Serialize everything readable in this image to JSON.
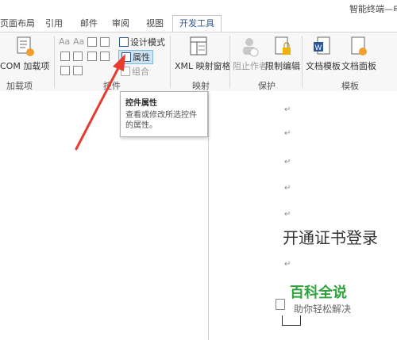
{
  "window": {
    "title": "智能终端—电子"
  },
  "tabs": [
    "页面布局",
    "引用",
    "邮件",
    "审阅",
    "视图",
    "开发工具"
  ],
  "ribbon": {
    "addins": {
      "com_label": "COM 加载项",
      "group": "加载项"
    },
    "controls": {
      "design_mode": "设计模式",
      "properties": "属性",
      "group_btn": "组合",
      "group": "控件"
    },
    "mapping": {
      "xml_pane": "XML 映射窗格",
      "group": "映射"
    },
    "protect": {
      "block_authors": "阻止作者",
      "restrict_editing": "限制编辑",
      "group": "保护"
    },
    "templates": {
      "doc_template": "文档模板",
      "doc_panel": "文档面板",
      "group": "模板"
    }
  },
  "tooltip": {
    "title": "控件属性",
    "desc": "查看或修改所选控件的属性。"
  },
  "document": {
    "heading": "开通证书登录",
    "para_mark": "↵"
  },
  "watermark": {
    "brand": "百科全说",
    "slogan": "助你轻松解决"
  },
  "colors": {
    "accent": "#2b579a",
    "arrow": "#e63b2e",
    "watermark": "#2fa33b"
  }
}
